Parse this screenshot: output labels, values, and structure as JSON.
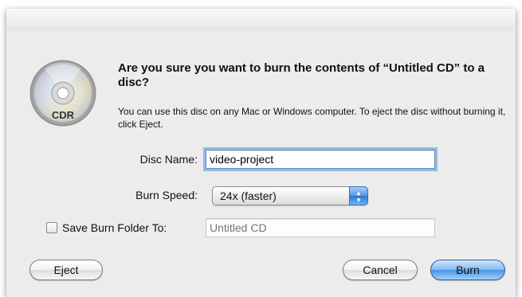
{
  "dialog": {
    "title": "Are you sure you want to burn the contents of “Untitled CD” to a disc?",
    "message": "You can use this disc on any Mac or Windows computer. To eject the disc without burning it, click Eject.",
    "disc_icon_label": "CDR"
  },
  "form": {
    "disc_name": {
      "label": "Disc Name:",
      "value": "video-project"
    },
    "burn_speed": {
      "label": "Burn Speed:",
      "selected": "24x (faster)"
    },
    "save_folder": {
      "label": "Save Burn Folder To:",
      "checked": false,
      "placeholder": "Untitled CD"
    }
  },
  "buttons": {
    "eject": "Eject",
    "cancel": "Cancel",
    "burn": "Burn"
  },
  "colors": {
    "sheet_background": "#ececec",
    "default_button": "#4b94e3",
    "focus_ring": "#98b9e4"
  }
}
